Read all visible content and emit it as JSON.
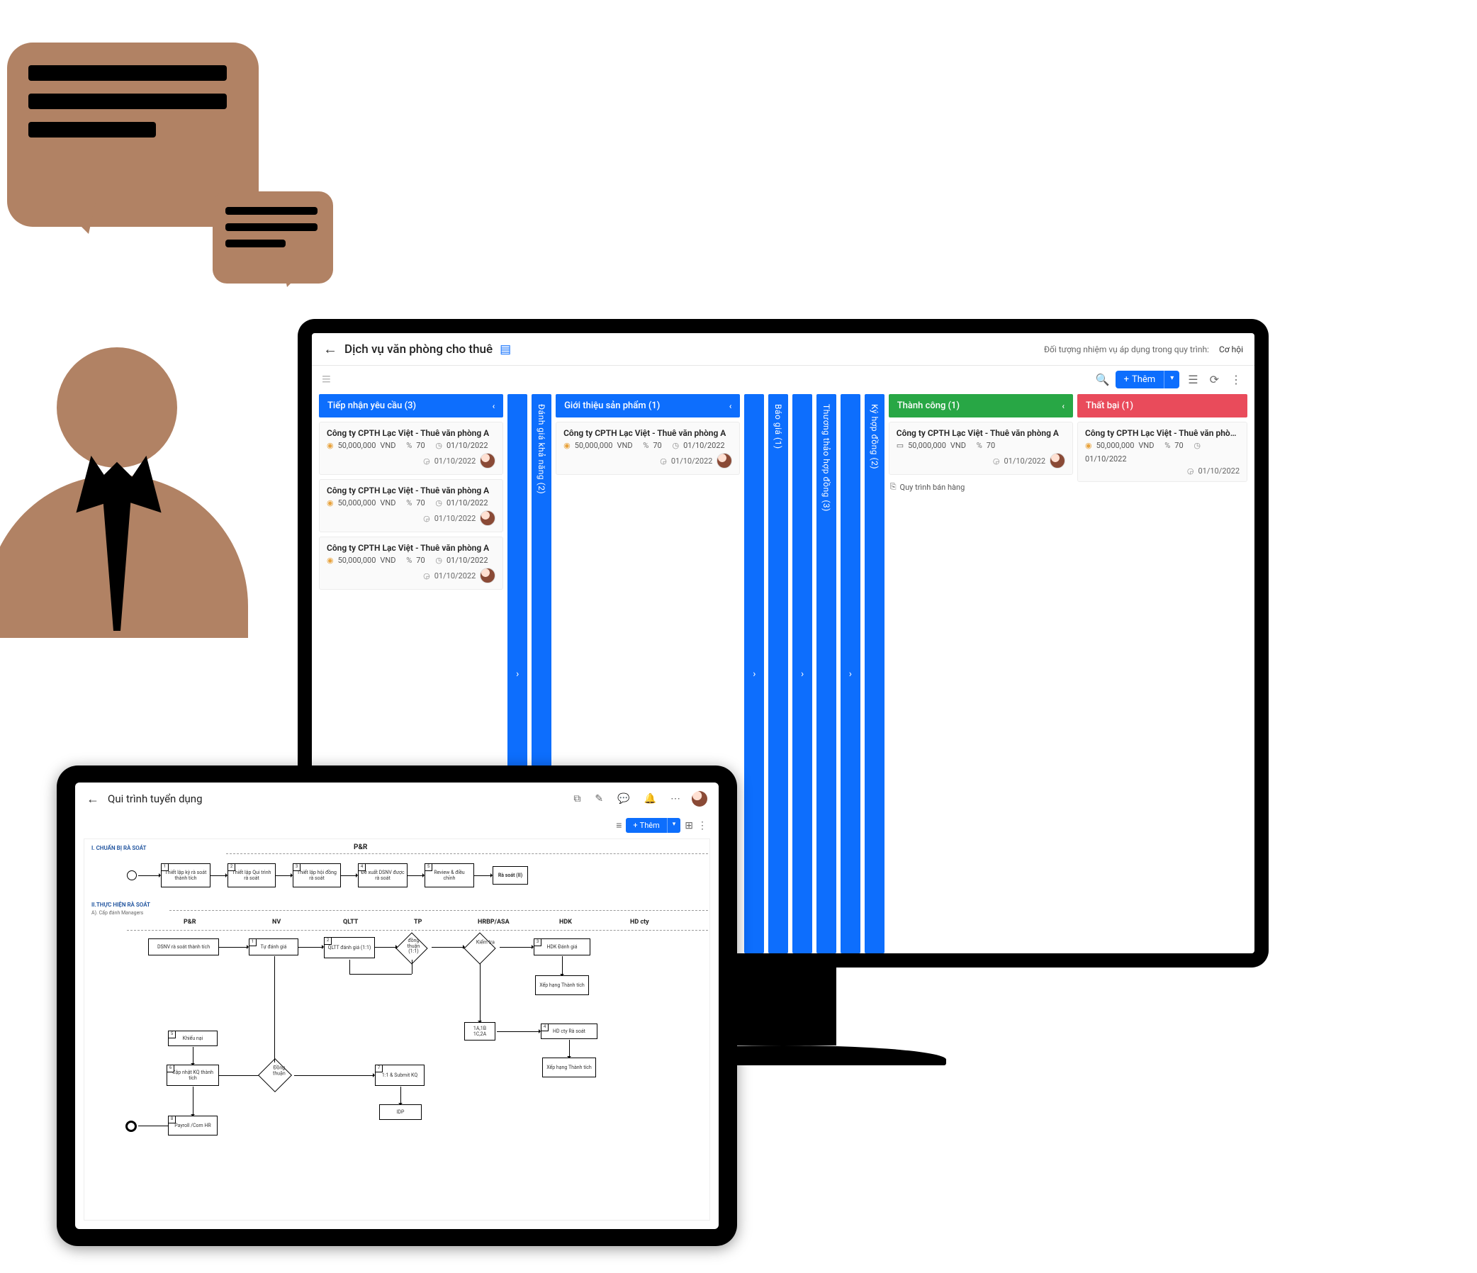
{
  "monitor": {
    "page_title": "Dịch vụ văn phòng cho thuê",
    "meta_label": "Đối tượng nhiệm vụ áp dụng trong quy trình:",
    "meta_value": "Cơ hội",
    "add_label": "Thêm",
    "columns": {
      "col1": {
        "label": "Tiếp nhận yêu cầu (3)"
      },
      "v1": {
        "label": "Đánh giá khả năng (2)"
      },
      "col2": {
        "label": "Giới thiệu sản phẩm (1)"
      },
      "v2": {
        "label": "Báo giá (1)"
      },
      "v3": {
        "label": "Thương thảo hợp đồng (3)"
      },
      "v4": {
        "label": "Ký hợp đồng (2)"
      },
      "col3": {
        "label": "Thành công (1)"
      },
      "col4": {
        "label": "Thất bại (1)"
      }
    },
    "card": {
      "title": "Công ty CPTH Lạc Việt - Thuê văn phòng A",
      "amount": "50,000,000",
      "currency": "VND",
      "percent": "70",
      "date": "01/10/2022",
      "date2": "01/10/2022"
    },
    "process_link": "Quy trình bán hàng"
  },
  "tablet": {
    "title": "Qui trình tuyển dụng",
    "add_label": "Thêm",
    "section1": "I. CHUẨN BỊ RÀ SOÁT",
    "section2": "II.THỰC HIỆN RÀ SOÁT",
    "section2_sub": "A). Cấp đánh Managers",
    "lanes": {
      "pr": "P&R",
      "pr2": "P&R",
      "nv": "NV",
      "qltt": "QLTT",
      "tp": "TP",
      "hrbp": "HRBP/ASA",
      "hdk": "HDK",
      "hdcty": "HD cty"
    },
    "nodes": {
      "n1": "Thiết lập kỳ rà soát thành tích",
      "n2": "Thiết lập Qui trình rà soát",
      "n3": "Thiết lập hội đồng rà soát",
      "n4": "Đề xuất DSNV được rà soát",
      "n5": "Review & điều chỉnh",
      "n6": "Rà soát (II)",
      "b1": "DSNV rà soát thành tích",
      "b2": "Tự đánh giá",
      "b3": "QLTT đánh giá (1:1)",
      "b4": "đồng thuận (1:1)",
      "b5": "Kiểm tra",
      "b6": "HDK Đánh giá",
      "b7": "Xếp hạng Thành tích",
      "b8": "Khiếu nại",
      "b9": "Cập nhật KQ thành tích",
      "b10": "Đồng thuận",
      "b11": "1:1 & Submit KQ",
      "b12": "IDP",
      "b13": "Payroll /Com HR",
      "b14": "1A,1B 1C,2A",
      "b15": "HD cty Rà soát",
      "b16": "Xếp hạng Thành tích"
    }
  }
}
